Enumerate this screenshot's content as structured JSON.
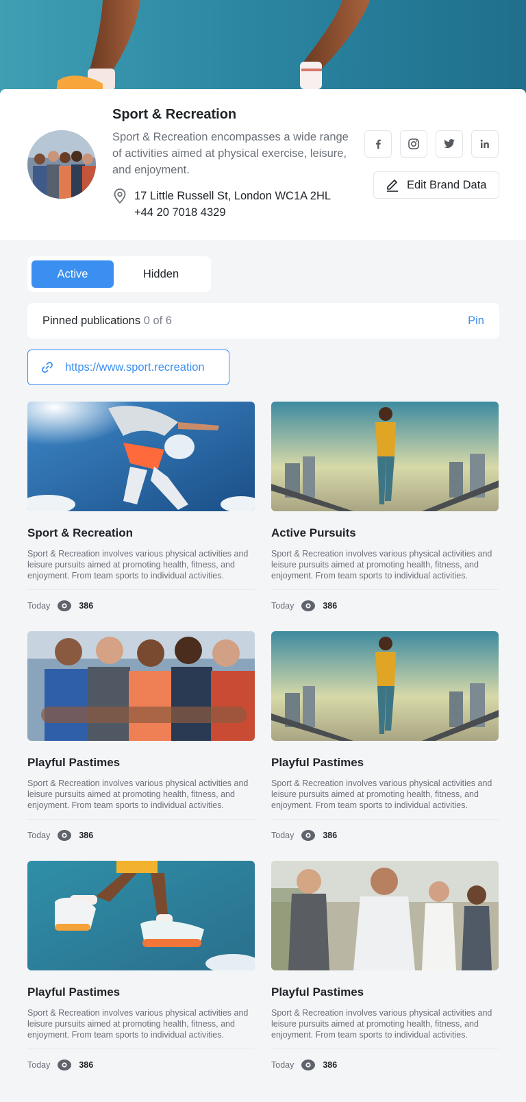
{
  "brand": {
    "title": "Sport & Recreation",
    "description": "Sport & Recreation encompasses a wide range of activities aimed at physical exercise, leisure, and enjoyment.",
    "address": "17 Little Russell St, London WC1A 2HL",
    "phone": "+44 20 7018 4329",
    "edit_label": "Edit Brand Data",
    "social": [
      "facebook-icon",
      "instagram-icon",
      "twitter-icon",
      "linkedin-icon"
    ]
  },
  "tabs": {
    "active": "Active",
    "hidden": "Hidden"
  },
  "pinned": {
    "label": "Pinned publications",
    "count": "0 of 6",
    "action": "Pin"
  },
  "url": {
    "text": "https://www.sport.recreation"
  },
  "colors": {
    "accent": "#3b8ff0",
    "background": "#f4f5f7",
    "text": "#1f2328",
    "muted": "#6b7078"
  },
  "cards": [
    {
      "title": "Sport & Recreation",
      "description": "Sport & Recreation involves various physical activities and leisure pursuits aimed at promoting health, fitness, and enjoyment. From team sports to individual activities.",
      "date": "Today",
      "views": "386"
    },
    {
      "title": "Active Pursuits",
      "description": "Sport & Recreation involves various physical activities and leisure pursuits aimed at promoting health, fitness, and enjoyment. From team sports to individual activities.",
      "date": "Today",
      "views": "386"
    },
    {
      "title": "Playful Pastimes",
      "description": "Sport & Recreation involves various physical activities and leisure pursuits aimed at promoting health, fitness, and enjoyment. From team sports to individual activities.",
      "date": "Today",
      "views": "386"
    },
    {
      "title": "Playful Pastimes",
      "description": "Sport & Recreation involves various physical activities and leisure pursuits aimed at promoting health, fitness, and enjoyment. From team sports to individual activities.",
      "date": "Today",
      "views": "386"
    },
    {
      "title": "Playful Pastimes",
      "description": "Sport & Recreation involves various physical activities and leisure pursuits aimed at promoting health, fitness, and enjoyment. From team sports to individual activities.",
      "date": "Today",
      "views": "386"
    },
    {
      "title": "Playful Pastimes",
      "description": "Sport & Recreation involves various physical activities and leisure pursuits aimed at promoting health, fitness, and enjoyment. From team sports to individual activities.",
      "date": "Today",
      "views": "386"
    }
  ]
}
